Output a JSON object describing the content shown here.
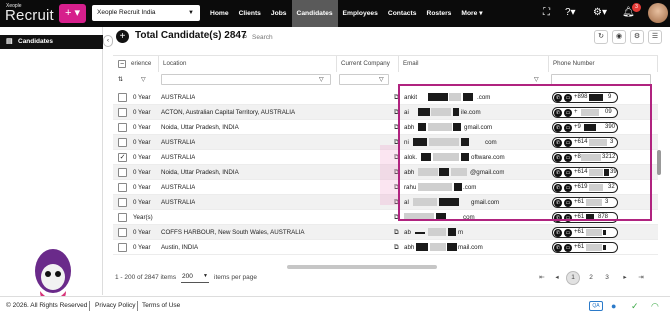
{
  "topbar": {
    "logo_small": "Xeople",
    "logo_big": "Recruit",
    "add_label": "+ ▾",
    "org_select_value": "Xeople Recruit India",
    "nav": [
      {
        "label": "Home"
      },
      {
        "label": "Clients"
      },
      {
        "label": "Jobs"
      },
      {
        "label": "Candidates",
        "active": true
      },
      {
        "label": "Employees"
      },
      {
        "label": "Contacts"
      },
      {
        "label": "Rosters"
      },
      {
        "label": "More ▾"
      }
    ],
    "notification_count": "3",
    "icons": [
      "fullscreen-icon",
      "help-icon",
      "settings-icon",
      "bell-icon",
      "user-avatar"
    ]
  },
  "sidebar": {
    "title": "Candidates",
    "collapse_glyph": "‹"
  },
  "main": {
    "title": "Total Candidate(s) 2847",
    "search_placeholder": "Search",
    "columns": {
      "experience": "erience",
      "location": "Location",
      "company": "Current Company",
      "email": "Email",
      "phone": "Phone Number"
    },
    "rows": [
      {
        "experience": "0 Year",
        "location": "AUSTRALIA",
        "email_start": "ankit",
        "email_end": ".com",
        "phone_start": "+898",
        "phone_end": "9",
        "checked": false
      },
      {
        "experience": "0 Year",
        "location": "ACTON, Australian Capital Territory, AUSTRALIA",
        "email_start": "ai",
        "email_end": "ile.com",
        "phone_start": "+",
        "phone_end": "09",
        "checked": false
      },
      {
        "experience": "0 Year",
        "location": "Noida, Uttar Pradesh, INDIA",
        "email_start": "abh",
        "email_end": "gmail.com",
        "phone_start": "+9",
        "phone_end": "390",
        "checked": false
      },
      {
        "experience": "0 Year",
        "location": "AUSTRALIA",
        "email_start": "ni",
        "email_end": "com",
        "phone_start": "+614",
        "phone_end": "3",
        "checked": false
      },
      {
        "experience": "0 Year",
        "location": "AUSTRALIA",
        "email_start": "alok.",
        "email_end": "oftware.com",
        "phone_start": "+8",
        "phone_end": "3212",
        "checked": true
      },
      {
        "experience": "0 Year",
        "location": "Noida, Uttar Pradesh, INDIA",
        "email_start": "abh",
        "email_end": "@gmail.com",
        "phone_start": "+614",
        "phone_end": "39",
        "checked": false
      },
      {
        "experience": "0 Year",
        "location": "AUSTRALIA",
        "email_start": "rahu",
        "email_end": ".com",
        "phone_start": "+619",
        "phone_end": "32",
        "checked": false
      },
      {
        "experience": "0 Year",
        "location": "AUSTRALIA",
        "email_start": "al",
        "email_end": "gmail.com",
        "phone_start": "+61",
        "phone_end": "3",
        "checked": false
      },
      {
        "experience": "Year(s)",
        "location": "",
        "email_start": "",
        "email_end": "com",
        "phone_start": "+61",
        "phone_end": "878",
        "checked": false
      },
      {
        "experience": "0 Year",
        "location": "COFFS HARBOUR, New South Wales, AUSTRALIA",
        "email_start": "ab",
        "email_end": "m",
        "phone_start": "+61",
        "phone_end": "",
        "checked": false
      },
      {
        "experience": "0 Year",
        "location": "Austin, INDIA",
        "email_start": "abh",
        "email_end": "mail.com",
        "phone_start": "+61",
        "phone_end": "",
        "checked": false
      }
    ]
  },
  "pager": {
    "summary": "1 - 200 of 2847 items",
    "per_page_value": "200",
    "per_page_label": "items per page",
    "pages": [
      "1",
      "2",
      "3"
    ],
    "first": "⇤",
    "prev": "◂",
    "next": "▸",
    "last": "⇥"
  },
  "footer": {
    "copyright": "© 2026. All Rights Reserved",
    "privacy": "Privacy Policy",
    "terms": "Terms of Use",
    "qa_label": "QA"
  },
  "colors": {
    "brand_pink": "#d61f8c",
    "highlight_border": "#b0237f",
    "topbar_bg": "#0b0b0b"
  }
}
